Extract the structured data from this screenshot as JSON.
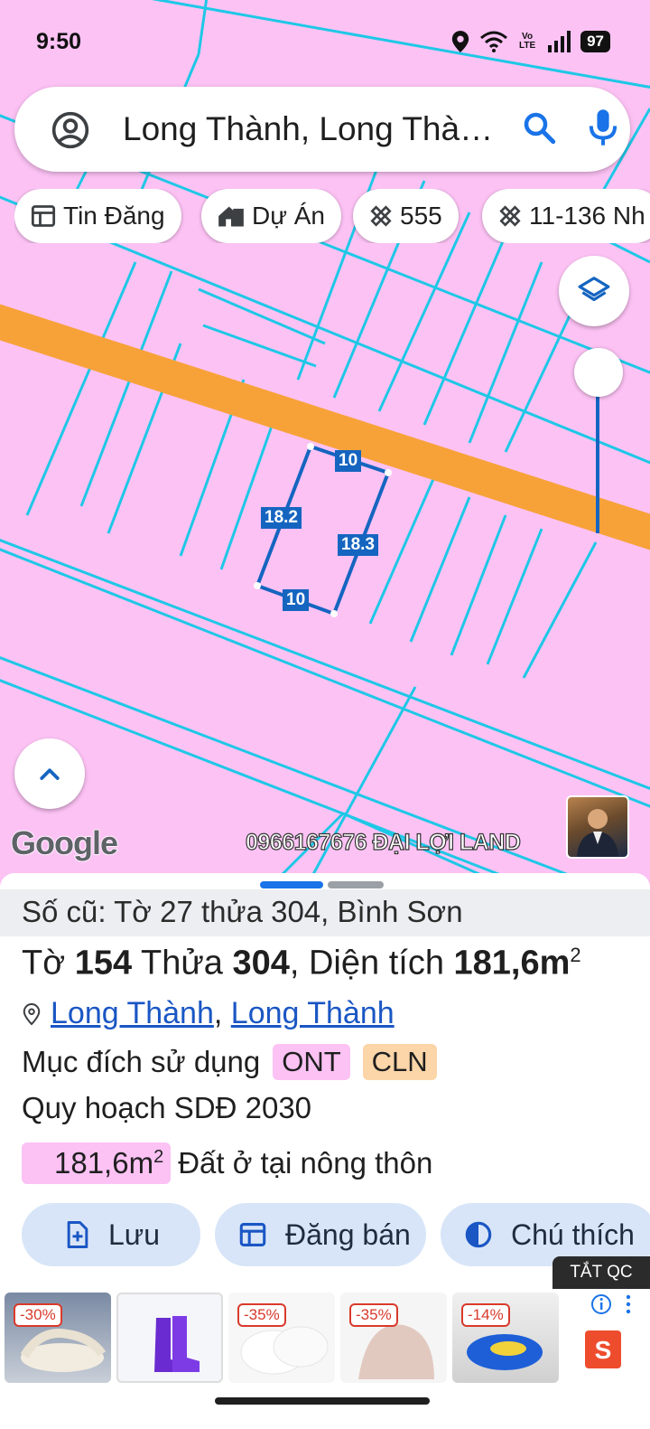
{
  "status_bar": {
    "time": "9:50",
    "network_label": "Vo LTE",
    "battery": "97",
    "icons": [
      "location-icon",
      "wifi-icon",
      "volte-icon",
      "signal-icon",
      "battery-icon"
    ]
  },
  "search": {
    "text": "Long Thành, Long Thà…",
    "icons": [
      "account-icon",
      "search-icon",
      "mic-icon"
    ]
  },
  "chips": [
    {
      "label": "Tin Đăng",
      "icon": "listing-icon"
    },
    {
      "label": "Dự Án",
      "icon": "project-icon"
    },
    {
      "label": "555",
      "icon": "ruler-icon"
    },
    {
      "label": "11-136 Nh",
      "icon": "ruler-icon"
    }
  ],
  "map": {
    "land_color": "#fcc2f4",
    "road_color": "#f7a239",
    "boundary_color": "#1ec8e6",
    "highlight_color": "#1565c0",
    "dimensions": {
      "top": "10",
      "left": "18.2",
      "right": "18.3",
      "bottom": "10"
    },
    "provider": "Google",
    "watermark": "0966167676 ĐẠI LỢI LAND"
  },
  "panel": {
    "old_info": "Số cũ: Tờ 27 thửa 304, Bình Sơn",
    "sheet_label": "Tờ",
    "sheet_no": "154",
    "parcel_label": "Thửa",
    "parcel_no": "304",
    "area_label": ", Diện tích",
    "area_value": "181,6m",
    "area_sup": "2",
    "location_link_1": "Long Thành",
    "location_sep": ",",
    "location_link_2": "Long Thành",
    "purpose_label": "Mục đích sử dụng",
    "tags": [
      {
        "code": "ONT",
        "color": "#fcc2f4"
      },
      {
        "code": "CLN",
        "color": "#fcd5a8"
      }
    ],
    "plan_label": "Quy hoạch SDĐ 2030",
    "zone_area": "181,6m",
    "zone_sup": "2",
    "zone_desc": "Đất ở tại nông thôn"
  },
  "actions": [
    {
      "label": "Lưu",
      "icon": "save-icon"
    },
    {
      "label": "Đăng bán",
      "icon": "listing-icon"
    },
    {
      "label": "Chú thích",
      "icon": "legend-icon"
    }
  ],
  "ads_off_label": "TẮT QC",
  "ads": [
    {
      "discount": "-30%",
      "product": "white-sandals"
    },
    {
      "discount": "",
      "product": "purple-rain-boots"
    },
    {
      "discount": "-35%",
      "product": "white-pads"
    },
    {
      "discount": "-35%",
      "product": "beige-pads"
    },
    {
      "discount": "-14%",
      "product": "blue-clogs"
    }
  ],
  "shop_label": "S"
}
